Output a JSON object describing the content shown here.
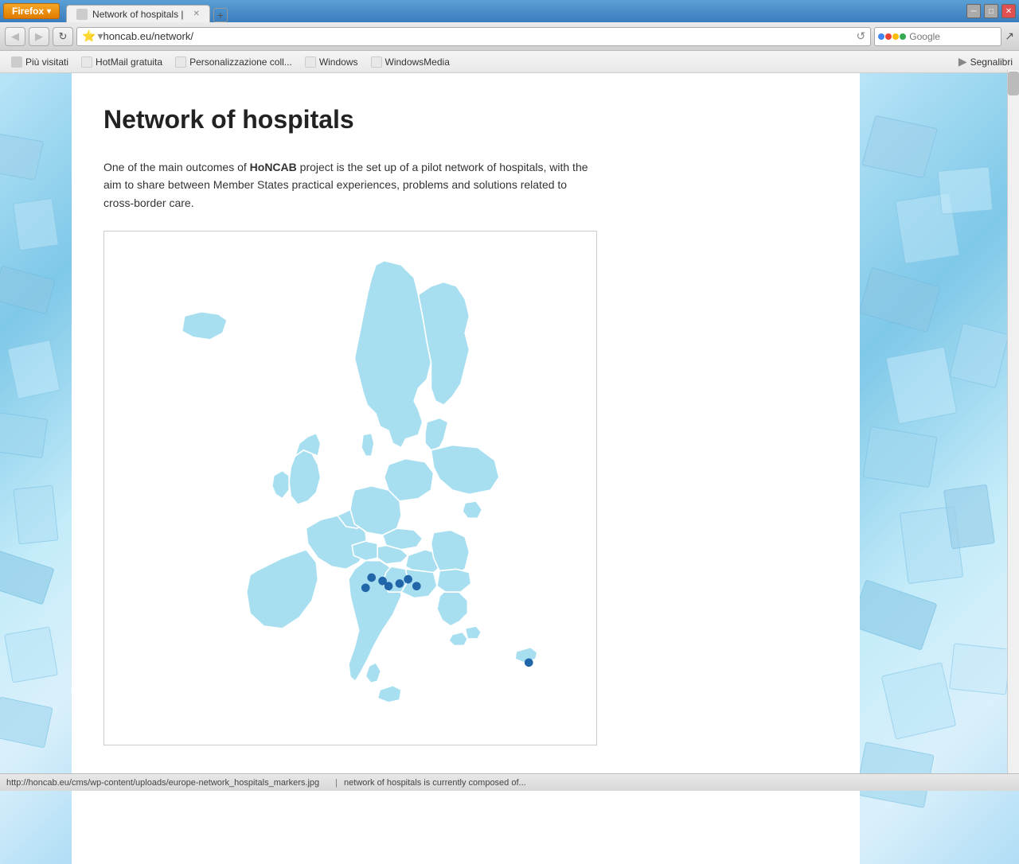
{
  "browser": {
    "tab_title": "Network of hospitals |",
    "address": "honcab.eu/network/",
    "new_tab_label": "+",
    "search_placeholder": "Google",
    "window_title": "Network of hospitals"
  },
  "bookmarks": [
    {
      "label": "Più visitati"
    },
    {
      "label": "HotMail gratuita"
    },
    {
      "label": "Personalizzazione coll..."
    },
    {
      "label": "Windows"
    },
    {
      "label": "WindowsMedia"
    }
  ],
  "bookmarks_right": {
    "label": "Segnalibri"
  },
  "page": {
    "title": "Network of hospitals",
    "intro": "One of the main outcomes of ",
    "project_name": "HoNCAB",
    "intro_rest": " project is the set up of a pilot network of hospitals, with the aim to share between Member States practical experiences, problems and solutions related to cross-border care."
  },
  "status_bar": {
    "url": "http://honcab.eu/cms/wp-content/uploads/europe-network_hospitals_markers.jpg",
    "bottom_text": "network of hospitals is currently composed of..."
  }
}
